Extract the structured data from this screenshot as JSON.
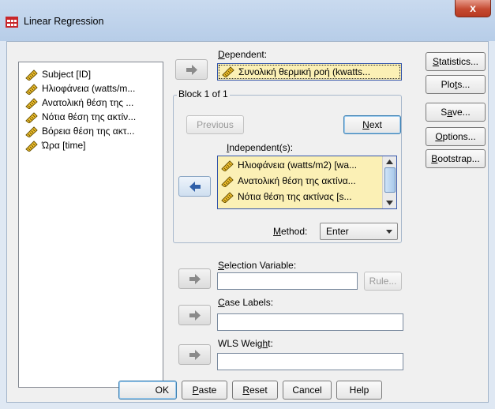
{
  "window": {
    "title": "Linear Regression",
    "close_glyph": "x"
  },
  "variables": [
    "Subject [ID]",
    "Ηλιοφάνεια (watts/m...",
    "Ανατολική θέση της ...",
    "Νότια θέση της ακτίν...",
    "Βόρεια θέση της ακτ...",
    "Ώρα [time]"
  ],
  "dependent": {
    "label_pre": "",
    "label_ul": "D",
    "label_post": "ependent:",
    "value": "Συνολική θερμική ροή (kwatts..."
  },
  "block": {
    "legend": "Block 1 of 1",
    "previous": "Previous",
    "next_ul": "N",
    "next_rest": "ext",
    "independent_label_pre": "",
    "independent_label_ul": "I",
    "independent_label_post": "ndependent(s):",
    "independents": [
      "Ηλιοφάνεια (watts/m2) [wa...",
      "Ανατολική θέση της ακτίνα...",
      "Νότια θέση της ακτίνας [s..."
    ],
    "method_label_ul": "M",
    "method_label_rest": "ethod:",
    "method_value": "Enter"
  },
  "selection": {
    "label_ul": "S",
    "label_rest": "election Variable:",
    "rule_button": "Rule..."
  },
  "case_labels": {
    "label_ul": "C",
    "label_rest": "ase Labels:"
  },
  "wls": {
    "label_pre": "WLS Weig",
    "label_ul": "h",
    "label_post": "t:"
  },
  "side_buttons": {
    "statistics_ul": "S",
    "statistics_rest": "tatistics...",
    "plots_pre": "Plo",
    "plots_ul": "t",
    "plots_post": "s...",
    "save_pre": "S",
    "save_ul": "a",
    "save_post": "ve...",
    "options_ul": "O",
    "options_rest": "ptions...",
    "bootstrap_ul": "B",
    "bootstrap_rest": "ootstrap..."
  },
  "bottom_buttons": {
    "ok": "OK",
    "paste_ul": "P",
    "paste_rest": "aste",
    "reset_ul": "R",
    "reset_rest": "eset",
    "cancel": "Cancel",
    "help": "Help"
  },
  "colors": {
    "selected_field": "#fbf0b5",
    "accent_blue": "#3355aa"
  }
}
